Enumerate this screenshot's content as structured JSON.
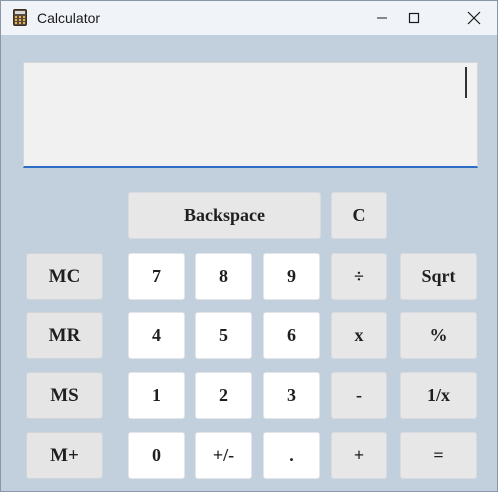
{
  "window": {
    "title": "Calculator"
  },
  "display": {
    "value": ""
  },
  "buttons": {
    "backspace": "Backspace",
    "clear": "C",
    "mc": "MC",
    "mr": "MR",
    "ms": "MS",
    "mplus": "M+",
    "d7": "7",
    "d8": "8",
    "d9": "9",
    "d4": "4",
    "d5": "5",
    "d6": "6",
    "d1": "1",
    "d2": "2",
    "d3": "3",
    "d0": "0",
    "sign": "+/-",
    "dot": ".",
    "divide": "÷",
    "multiply": "x",
    "minus": "-",
    "plus": "+",
    "sqrt": "Sqrt",
    "percent": "%",
    "reciprocal": "1/x",
    "equals": "="
  }
}
